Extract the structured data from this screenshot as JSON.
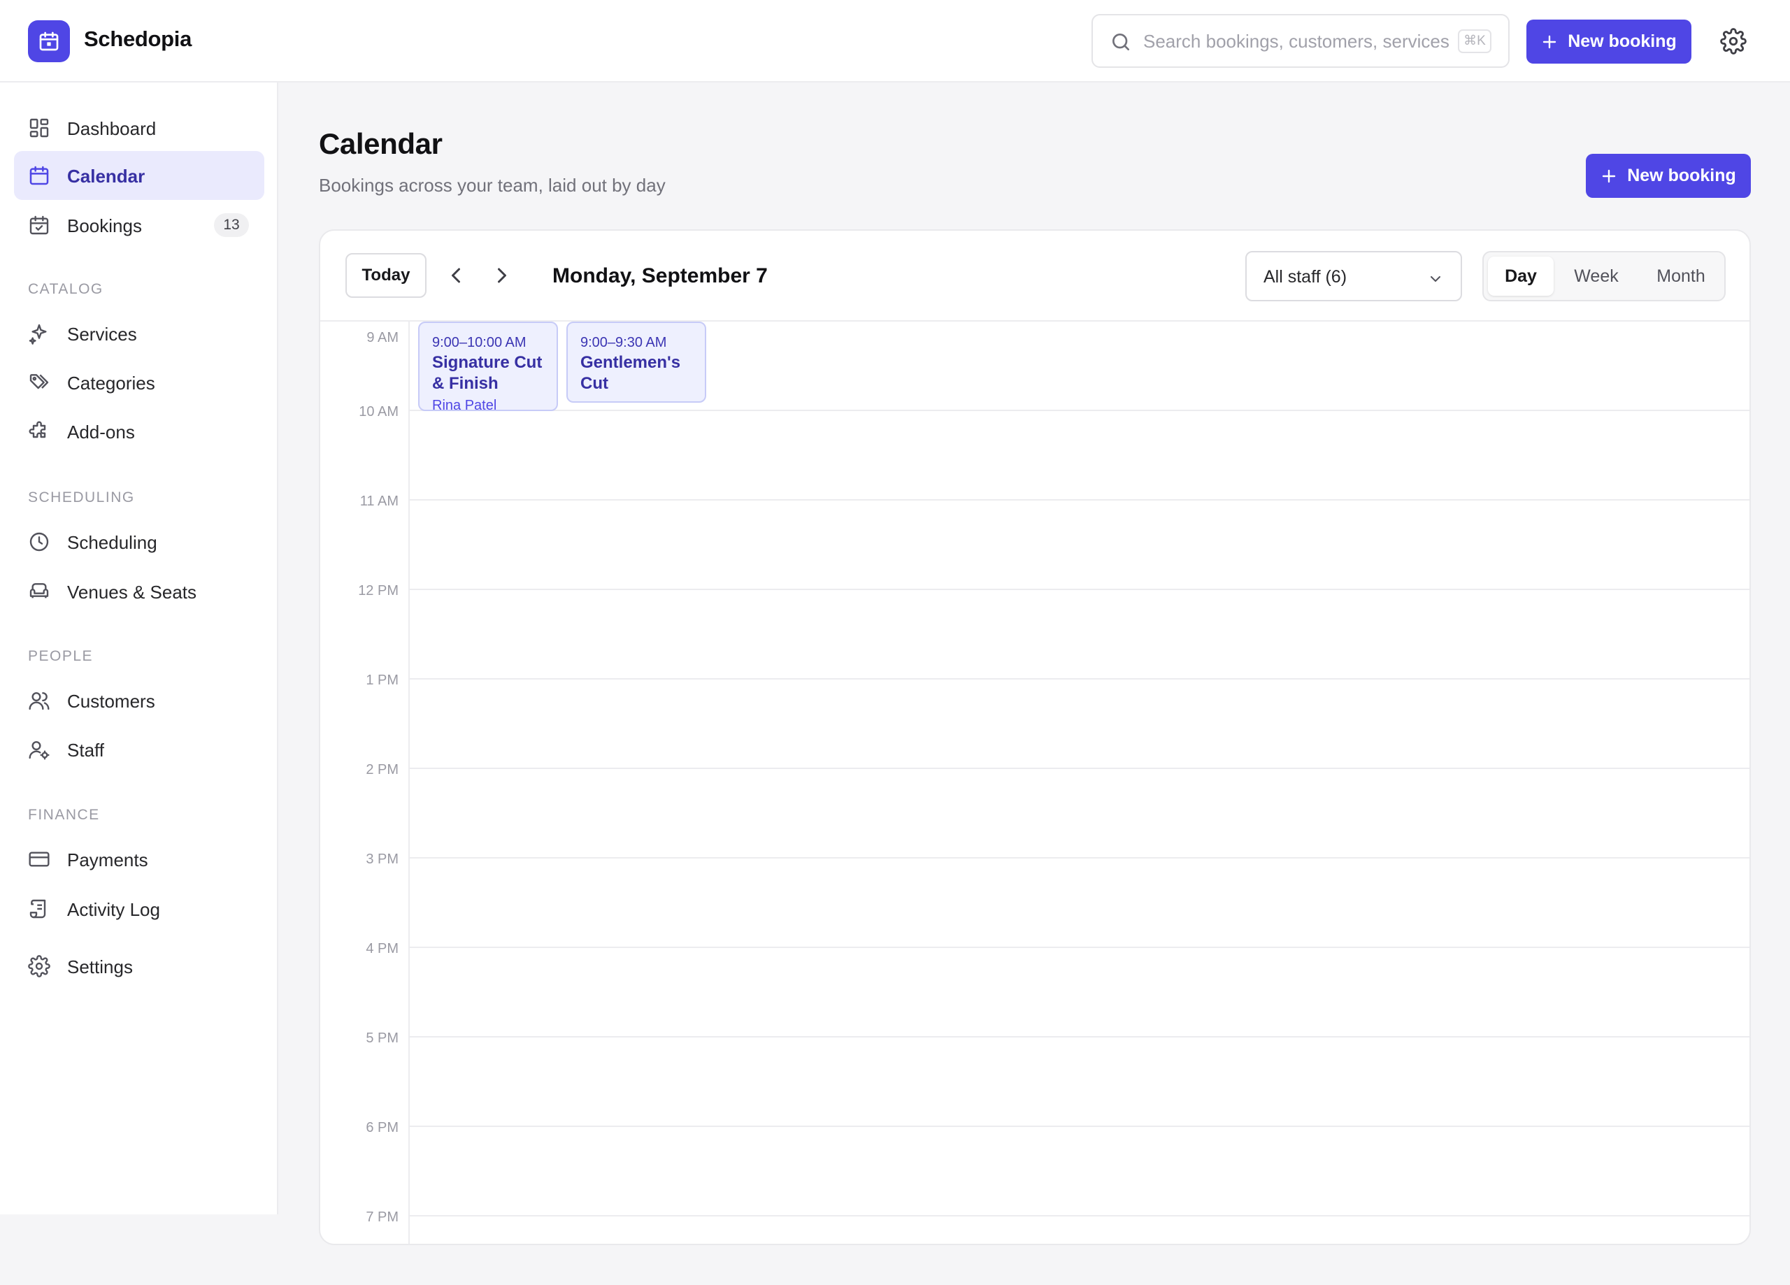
{
  "app": {
    "name": "Schedopia"
  },
  "topbar": {
    "search_placeholder": "Search bookings, customers, services",
    "search_shortcut": "⌘K",
    "new_booking_label": "New booking"
  },
  "sidebar": {
    "items": [
      {
        "label": "Dashboard",
        "icon": "dashboard-icon"
      },
      {
        "label": "Calendar",
        "icon": "calendar-icon",
        "active": true
      },
      {
        "label": "Bookings",
        "icon": "calendar-check-icon",
        "badge": "13"
      }
    ],
    "sections": [
      {
        "label": "CATALOG",
        "items": [
          {
            "label": "Services",
            "icon": "sparkles-icon"
          },
          {
            "label": "Categories",
            "icon": "tags-icon"
          },
          {
            "label": "Add-ons",
            "icon": "puzzle-icon"
          }
        ]
      },
      {
        "label": "SCHEDULING",
        "items": [
          {
            "label": "Scheduling",
            "icon": "clock-icon"
          },
          {
            "label": "Venues & Seats",
            "icon": "armchair-icon"
          }
        ]
      },
      {
        "label": "PEOPLE",
        "items": [
          {
            "label": "Customers",
            "icon": "users-icon"
          },
          {
            "label": "Staff",
            "icon": "user-cog-icon"
          }
        ]
      },
      {
        "label": "FINANCE",
        "items": [
          {
            "label": "Payments",
            "icon": "credit-card-icon"
          },
          {
            "label": "Activity Log",
            "icon": "scroll-icon"
          }
        ]
      }
    ],
    "footer_item": {
      "label": "Settings",
      "icon": "gear-icon"
    }
  },
  "page": {
    "title": "Calendar",
    "subtitle": "Bookings across your team, laid out by day",
    "new_booking_label": "New booking"
  },
  "calendar": {
    "today_label": "Today",
    "date_label": "Monday, September 7",
    "staff_filter": "All staff (6)",
    "views": [
      "Day",
      "Week",
      "Month"
    ],
    "active_view": "Day",
    "hours": [
      "9 AM",
      "10 AM",
      "11 AM",
      "12 PM",
      "1 PM",
      "2 PM",
      "3 PM",
      "4 PM",
      "5 PM",
      "6 PM",
      "7 PM"
    ],
    "events": [
      {
        "time": "9:00–10:00 AM",
        "title": "Signature Cut & Finish",
        "person": "Rina Patel"
      },
      {
        "time": "9:00–9:30 AM",
        "title": "Gentlemen's Cut",
        "person": ""
      }
    ]
  },
  "colors": {
    "accent": "#4f46e5",
    "active_nav_bg": "#eaeafd",
    "event_bg": "#eef0fe"
  }
}
